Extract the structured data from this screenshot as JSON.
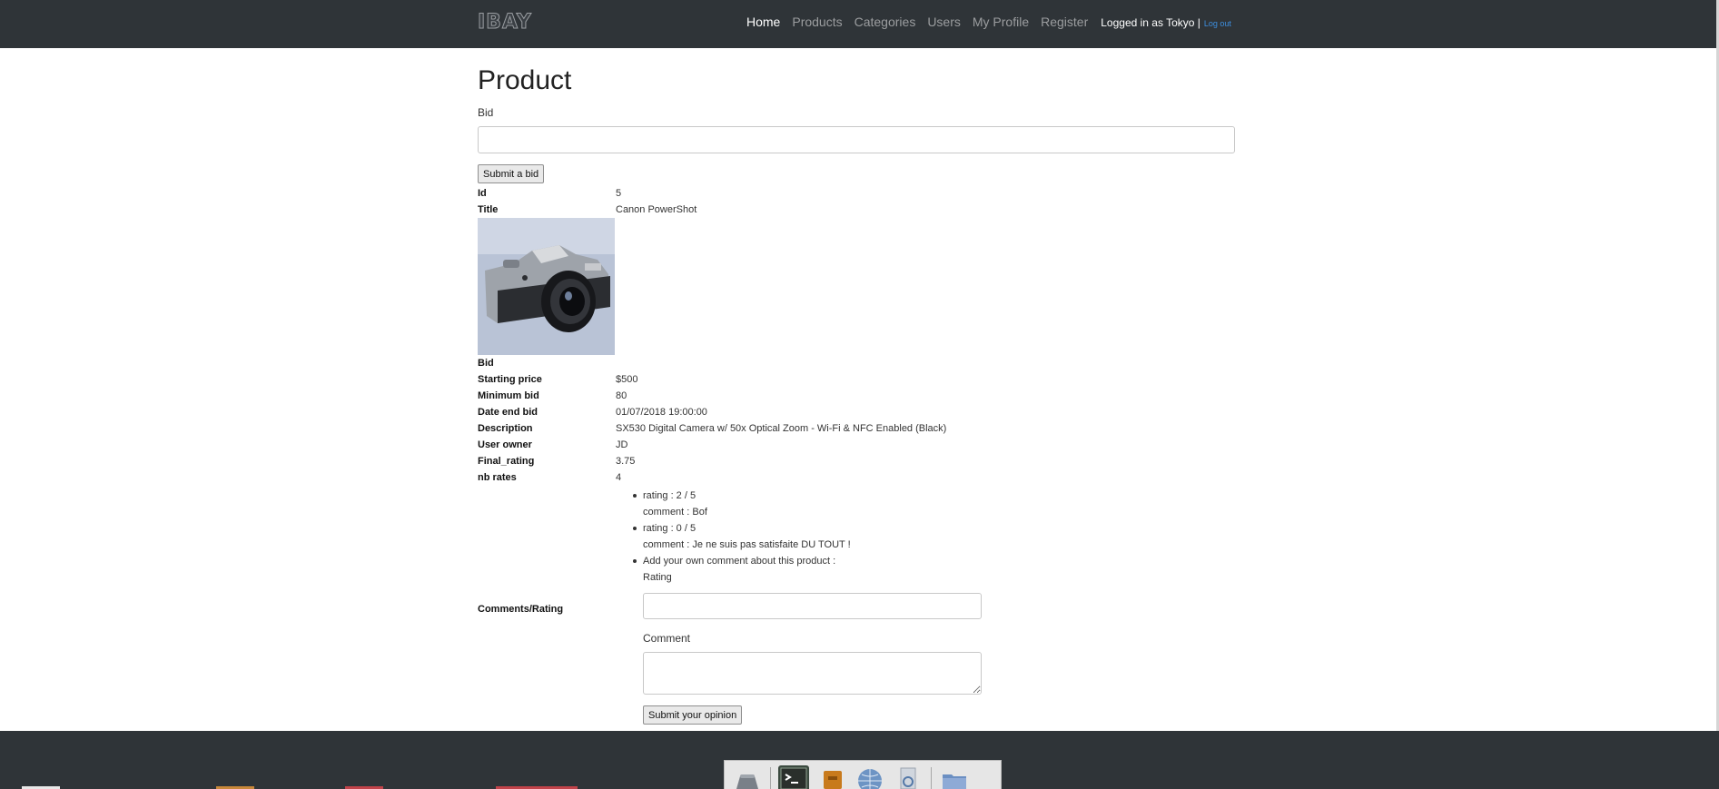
{
  "navbar": {
    "brand": "IBAY",
    "links": [
      "Home",
      "Products",
      "Categories",
      "Users",
      "My Profile",
      "Register"
    ],
    "logged_in": "Logged in as Tokyo |",
    "logout": "Log out"
  },
  "page": {
    "title": "Product",
    "bid_label": "Bid",
    "bid_value": "",
    "submit_bid": "Submit a bid"
  },
  "product": {
    "id": {
      "label": "Id",
      "value": "5"
    },
    "title": {
      "label": "Title",
      "value": "Canon PowerShot"
    },
    "bid": {
      "label": "Bid"
    },
    "starting_price": {
      "label": "Starting price",
      "value": "$500"
    },
    "minimum_bid": {
      "label": "Minimum bid",
      "value": "80"
    },
    "date_end_bid": {
      "label": "Date end bid",
      "value": "01/07/2018 19:00:00"
    },
    "description": {
      "label": "Description",
      "value": "SX530 Digital Camera w/ 50x Optical Zoom - Wi-Fi & NFC Enabled (Black)"
    },
    "user_owner": {
      "label": "User owner",
      "value": "JD"
    },
    "final_rating": {
      "label": "Final_rating",
      "value": "3.75"
    },
    "nb_rates": {
      "label": "nb rates",
      "value": "4"
    }
  },
  "comments": {
    "label": "Comments/Rating",
    "items": [
      {
        "rating": "rating : 2 / 5",
        "comment": "comment : Bof"
      },
      {
        "rating": "rating : 0 / 5",
        "comment": "comment : Je ne suis pas satisfaite DU TOUT !"
      }
    ],
    "add_own": "Add your own comment about this product :",
    "rating_label": "Rating",
    "rating_value": "",
    "comment_label": "Comment",
    "comment_value": "",
    "submit": "Submit your opinion"
  },
  "colors": {
    "navbar": "#2f3438",
    "link_active": "#ffffff",
    "link": "#9b9d9f",
    "logout": "#3d8fe0"
  },
  "dock_icons": [
    "drive-icon",
    "terminal-icon",
    "archive-icon",
    "globe-icon",
    "search-icon",
    "folder-icon"
  ]
}
